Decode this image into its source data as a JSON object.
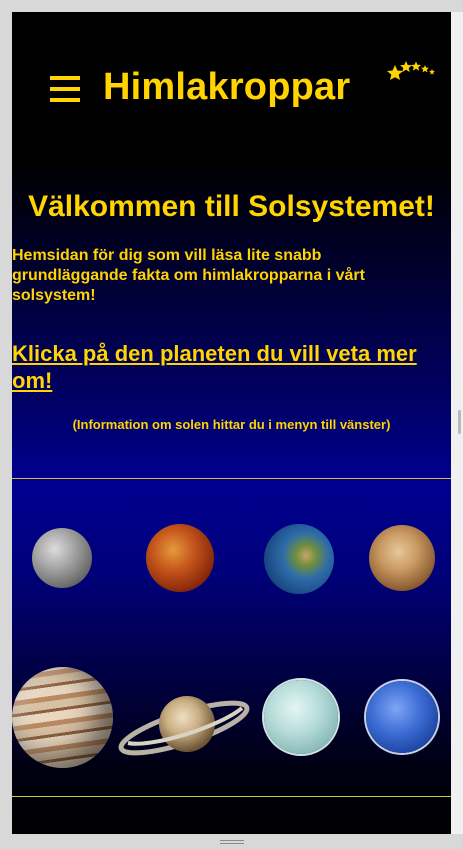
{
  "header": {
    "site_title": "Himlakroppar",
    "menu_icon": "hamburger-menu-icon",
    "logo_icon": "stars-logo-icon"
  },
  "main": {
    "welcome_title": "Välkommen till Solsystemet!",
    "intro_text": "Hemsidan för dig som vill läsa lite snabb grundläggande fakta om himlakropparna i vårt solsystem!",
    "cta_link": "Klicka på den planeten du vill veta mer om!",
    "sun_note": "(Information om solen hittar du i menyn till vänster)"
  },
  "planets": [
    "mercury",
    "venus",
    "earth",
    "mars",
    "jupiter",
    "saturn",
    "uranus",
    "neptune"
  ],
  "colors": {
    "accent": "#ffd400",
    "background_top": "#000000",
    "background_mid": "#000090"
  }
}
